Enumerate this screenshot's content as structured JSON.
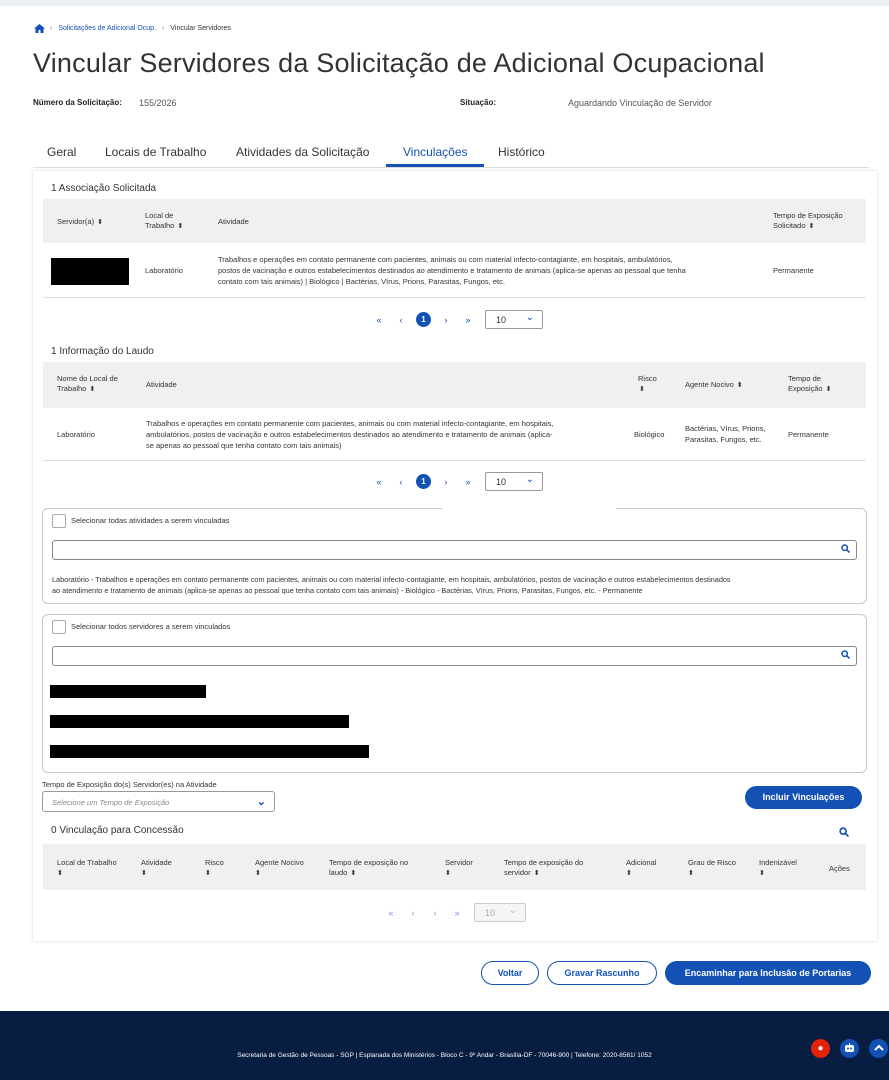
{
  "breadcrumb": {
    "item1": "Solicitações de Adicional Ocup.",
    "item2": "Vincular Servidores"
  },
  "page_title": "Vincular Servidores da Solicitação de Adicional Ocupacional",
  "meta": {
    "numero_label": "Número da Solicitação:",
    "numero_value": "155/2026",
    "situacao_label": "Situação:",
    "situacao_value": "Aguardando Vinculação de Servidor"
  },
  "tabs": [
    "Geral",
    "Locais de Trabalho",
    "Atividades da Solicitação",
    "Vinculações",
    "Histórico"
  ],
  "assoc": {
    "title": "1 Associação Solicitada",
    "headers": {
      "servidor": "Servidor(a)",
      "local1": "Local de",
      "local2": "Trabalho",
      "atividade": "Atividade",
      "tempo1": "Tempo de Exposição",
      "tempo2": "Solicitado"
    },
    "row": {
      "local": "Laboratório",
      "atividade1": "Trabalhos e operações em contato permanente com pacientes, animais ou com material infecto-contagiante, em hospitais, ambulatórios,",
      "atividade2": "postos de vacinação e outros estabelecimentos destinados ao atendimento e tratamento de animais (aplica-se apenas ao pessoal que tenha",
      "atividade3": "contato com tais animais) | Biológico | Bactérias, Vírus, Prions, Parasitas, Fungos, etc.",
      "tempo": "Permanente"
    }
  },
  "laudo": {
    "title": "1 Informação do Laudo",
    "headers": {
      "nome1": "Nome do Local de",
      "nome2": "Trabalho",
      "atividade": "Atividade",
      "risco": "Risco",
      "agente": "Agente Nocivo",
      "tempo1": "Tempo de",
      "tempo2": "Exposição"
    },
    "row": {
      "local": "Laboratório",
      "atividade1": "Trabalhos e operações em contato permanente com pacientes, animais ou com material infecto-contagiante, em hospitais,",
      "atividade2": "ambulatórios, postos de vacinação e outros estabelecimentos destinados ao atendimento e tratamento de animais (aplica-",
      "atividade3": "se apenas ao pessoal que tenha contato com tais animais)",
      "risco": "Biológico",
      "agente1": "Bactérias, Vírus, Prions,",
      "agente2": "Parasitas, Fungos, etc.",
      "tempo": "Permanente"
    }
  },
  "pager": {
    "first": "«",
    "prev": "‹",
    "page": "1",
    "next": "›",
    "last": "»",
    "size": "10"
  },
  "atividades_box": {
    "select_all": "Selecionar todas atividades a serem vinculadas",
    "item1": "Laboratório - Trabalhos e operações em contato permanente com pacientes, animais ou com material infecto-contagiante, em hospitais, ambulatórios, postos de vacinação e outros estabelecimentos destinados",
    "item2": "ao atendimento e tratamento de animais (aplica-se apenas ao pessoal que tenha contato com tais animais) - Biológico - Bactérias, Vírus, Prions, Parasitas, Fungos, etc. - Permanente"
  },
  "servidores_box": {
    "select_all": "Selecionar todos servidores a serem vinculados"
  },
  "tempo_select": {
    "label": "Tempo de Exposição do(s) Servidor(es) na Atividade",
    "placeholder": "Selecione um Tempo de Exposição"
  },
  "incluir_label": "Incluir Vinculações",
  "concessao": {
    "title": "0 Vinculação para Concessão",
    "headers": [
      {
        "l1": "Local de Trabalho",
        "l2": ""
      },
      {
        "l1": "Atividade",
        "l2": ""
      },
      {
        "l1": "Risco",
        "l2": ""
      },
      {
        "l1": "Agente Nocivo",
        "l2": ""
      },
      {
        "l1": "Tempo de exposição no",
        "l2": "laudo"
      },
      {
        "l1": "Servidor",
        "l2": ""
      },
      {
        "l1": "Tempo de exposição do",
        "l2": "servidor"
      },
      {
        "l1": "Adicional",
        "l2": ""
      },
      {
        "l1": "Grau de Risco",
        "l2": ""
      },
      {
        "l1": "Indenizável",
        "l2": ""
      }
    ],
    "acoes": "Ações"
  },
  "buttons": {
    "voltar": "Voltar",
    "rascunho": "Gravar Rascunho",
    "encaminhar": "Encaminhar para Inclusão de Portarias"
  },
  "footer": "Secretaria de Gestão de Pessoas - SGP | Esplanada dos Ministérios - Bloco C - 9º Andar - Brasília-DF - 70046-900 | Telefone: 2020-8561/ 1052",
  "colors": {
    "primary": "#1351b4",
    "footer_bg": "#071d41",
    "fab_red": "#e52207"
  }
}
